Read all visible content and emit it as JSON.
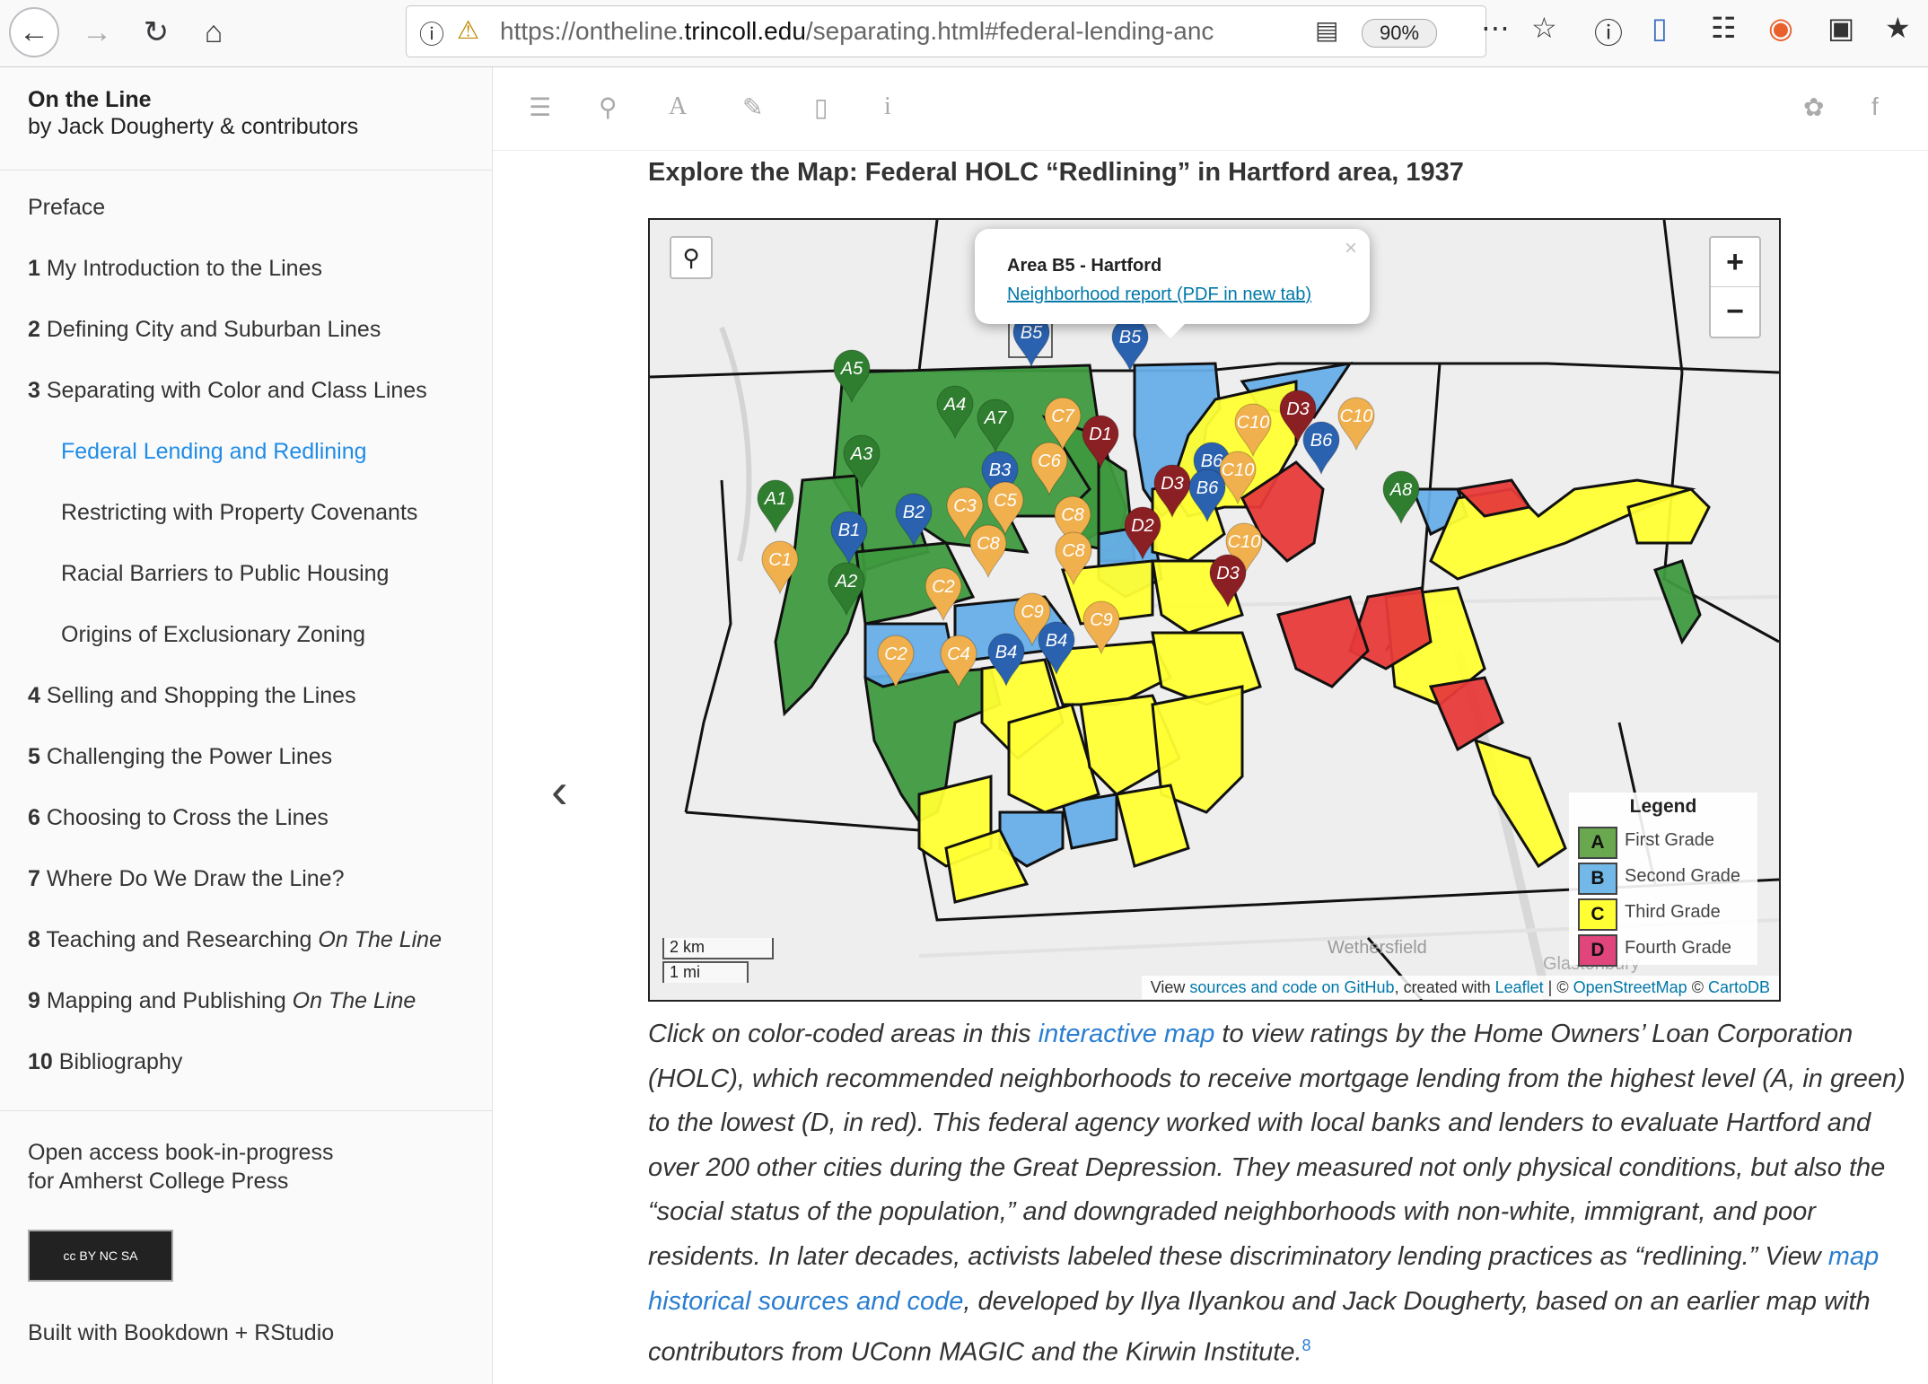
{
  "browser": {
    "url_prefix": "https://ontheline.",
    "url_domain": "trincoll.edu",
    "url_suffix": "/separating.html#federal-lending-anc",
    "zoom": "90%"
  },
  "sidebar": {
    "title": "On the Line",
    "author": "by Jack Dougherty & contributors",
    "toc": [
      {
        "num": "",
        "label": "Preface",
        "sub": false,
        "active": false
      },
      {
        "num": "1",
        "label": "My Introduction to the Lines",
        "sub": false,
        "active": false
      },
      {
        "num": "2",
        "label": "Defining City and Suburban Lines",
        "sub": false,
        "active": false
      },
      {
        "num": "3",
        "label": "Separating with Color and Class Lines",
        "sub": false,
        "active": false
      },
      {
        "num": "",
        "label": "Federal Lending and Redlining",
        "sub": true,
        "active": true
      },
      {
        "num": "",
        "label": "Restricting with Property Covenants",
        "sub": true,
        "active": false
      },
      {
        "num": "",
        "label": "Racial Barriers to Public Housing",
        "sub": true,
        "active": false
      },
      {
        "num": "",
        "label": "Origins of Exclusionary Zoning",
        "sub": true,
        "active": false
      },
      {
        "num": "4",
        "label": "Selling and Shopping the Lines",
        "sub": false,
        "active": false
      },
      {
        "num": "5",
        "label": "Challenging the Power Lines",
        "sub": false,
        "active": false
      },
      {
        "num": "6",
        "label": "Choosing to Cross the Lines",
        "sub": false,
        "active": false
      },
      {
        "num": "7",
        "label": "Where Do We Draw the Line?",
        "sub": false,
        "active": false
      },
      {
        "num": "8",
        "label": "Teaching and Researching ",
        "italic": "On The Line",
        "sub": false,
        "active": false
      },
      {
        "num": "9",
        "label": "Mapping and Publishing ",
        "italic": "On The Line",
        "sub": false,
        "active": false
      },
      {
        "num": "10",
        "label": "Bibliography",
        "sub": false,
        "active": false
      }
    ],
    "open_access_1": "Open access book-in-progress",
    "open_access_2": "for Amherst College Press",
    "cc_badge": "cc BY NC SA",
    "built_with": "Built with Bookdown + RStudio"
  },
  "main": {
    "heading": "Explore the Map: Federal HOLC “Redlining” in Hartford area, 1937",
    "popup_title": "Area B5 - Hartford",
    "popup_link": "Neighborhood report (PDF in new tab)",
    "legend_title": "Legend",
    "legend": [
      {
        "code": "A",
        "label": "First Grade",
        "color": "#6aa84f"
      },
      {
        "code": "B",
        "label": "Second Grade",
        "color": "#72b8e8"
      },
      {
        "code": "C",
        "label": "Third Grade",
        "color": "#ffff33"
      },
      {
        "code": "D",
        "label": "Fourth Grade",
        "color": "#e0457b"
      }
    ],
    "scale_km": "2 km",
    "scale_mi": "1 mi",
    "place_wethersfield": "Wethersfield",
    "place_glastonbury": "Glastonbury",
    "attribution": {
      "view": "View ",
      "sources_link": "sources and code on GitHub",
      "created": ", created with ",
      "leaflet": "Leaflet",
      "sep": " | © ",
      "osm": "OpenStreetMap",
      "carto": "CartoDB"
    },
    "caption": {
      "p1": "Click on color-coded areas in this ",
      "link1": "interactive map",
      "p2": " to view ratings by the Home Owners’ Loan Corporation (HOLC), which recommended neighborhoods to receive mortgage lending from the highest level (A, in green) to the lowest (D, in red). This federal agency worked with local banks and lenders to evaluate Hartford and over 200 other cities during the Great Depression. They measured not only physical conditions, but also the “social status of the population,” and downgraded neighborhoods with non-white, immigrant, and poor residents. In later decades, activists labeled these discriminatory lending practices as “redlining.” View ",
      "link2": "map historical sources and code",
      "p3": ", developed by Ilya Ilyankou and Jack Dougherty, based on an earlier map with contributors from UConn MAGIC and the Kirwin Institute.",
      "footnote": "8"
    },
    "markers": [
      "B5",
      "B5",
      "A5",
      "A4",
      "A7",
      "C7",
      "D1",
      "D3",
      "C10",
      "C10",
      "B6",
      "A3",
      "B3",
      "C6",
      "B6",
      "C10",
      "D3",
      "B6",
      "A8",
      "A1",
      "B2",
      "C3",
      "C5",
      "C8",
      "D2",
      "B1",
      "C8",
      "C8",
      "C10",
      "C1",
      "A2",
      "C2",
      "D3",
      "C9",
      "C9",
      "C2",
      "C4",
      "B4",
      "B4"
    ]
  }
}
